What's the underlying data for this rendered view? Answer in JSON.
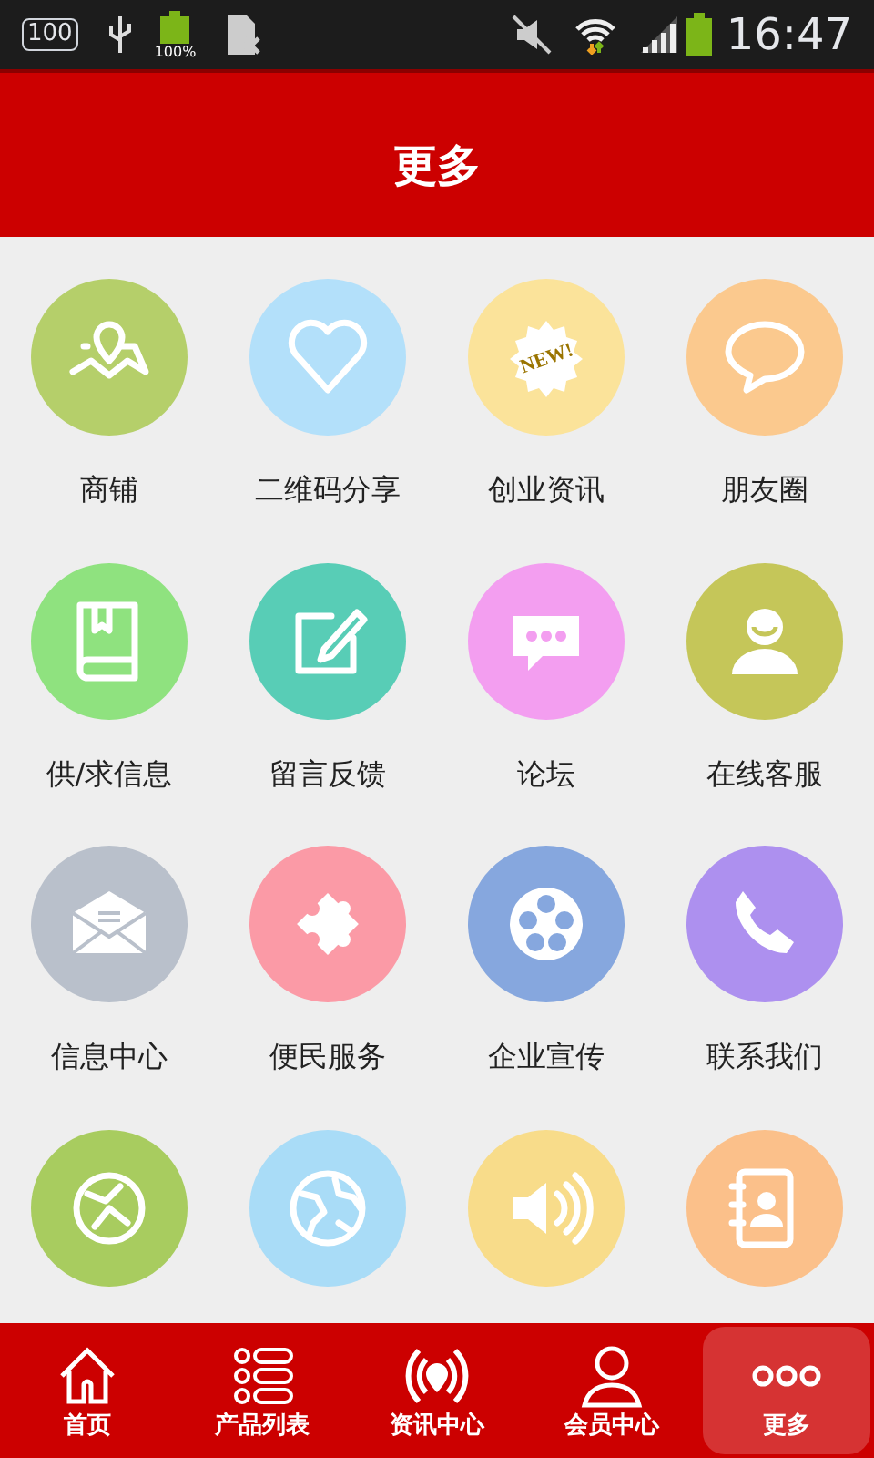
{
  "status_bar": {
    "storage": "100",
    "battery_notice": "100%",
    "time": "16:47"
  },
  "header": {
    "title": "更多"
  },
  "grid": [
    {
      "label": "商铺",
      "color": "#b5cf6a"
    },
    {
      "label": "二维码分享",
      "color": "#b3e0fa"
    },
    {
      "label": "创业资讯",
      "color": "#fbe39a",
      "icon_text": "NEW!"
    },
    {
      "label": "朋友圈",
      "color": "#fbc98e"
    },
    {
      "label": "供/求信息",
      "color": "#8fe27f"
    },
    {
      "label": "留言反馈",
      "color": "#58cdb6"
    },
    {
      "label": "论坛",
      "color": "#f39ef0"
    },
    {
      "label": "在线客服",
      "color": "#c5c659"
    },
    {
      "label": "信息中心",
      "color": "#b9c0cb"
    },
    {
      "label": "便民服务",
      "color": "#fb9aa6"
    },
    {
      "label": "企业宣传",
      "color": "#86a7de"
    },
    {
      "label": "联系我们",
      "color": "#ad90ef"
    },
    {
      "color": "#a8cc5f"
    },
    {
      "color": "#a9dcf7"
    },
    {
      "color": "#f8dc8a"
    },
    {
      "color": "#fbc08a"
    }
  ],
  "tabs": [
    {
      "label": "首页",
      "selected": false
    },
    {
      "label": "产品列表",
      "selected": false
    },
    {
      "label": "资讯中心",
      "selected": false
    },
    {
      "label": "会员中心",
      "selected": false
    },
    {
      "label": "更多",
      "selected": true
    }
  ]
}
